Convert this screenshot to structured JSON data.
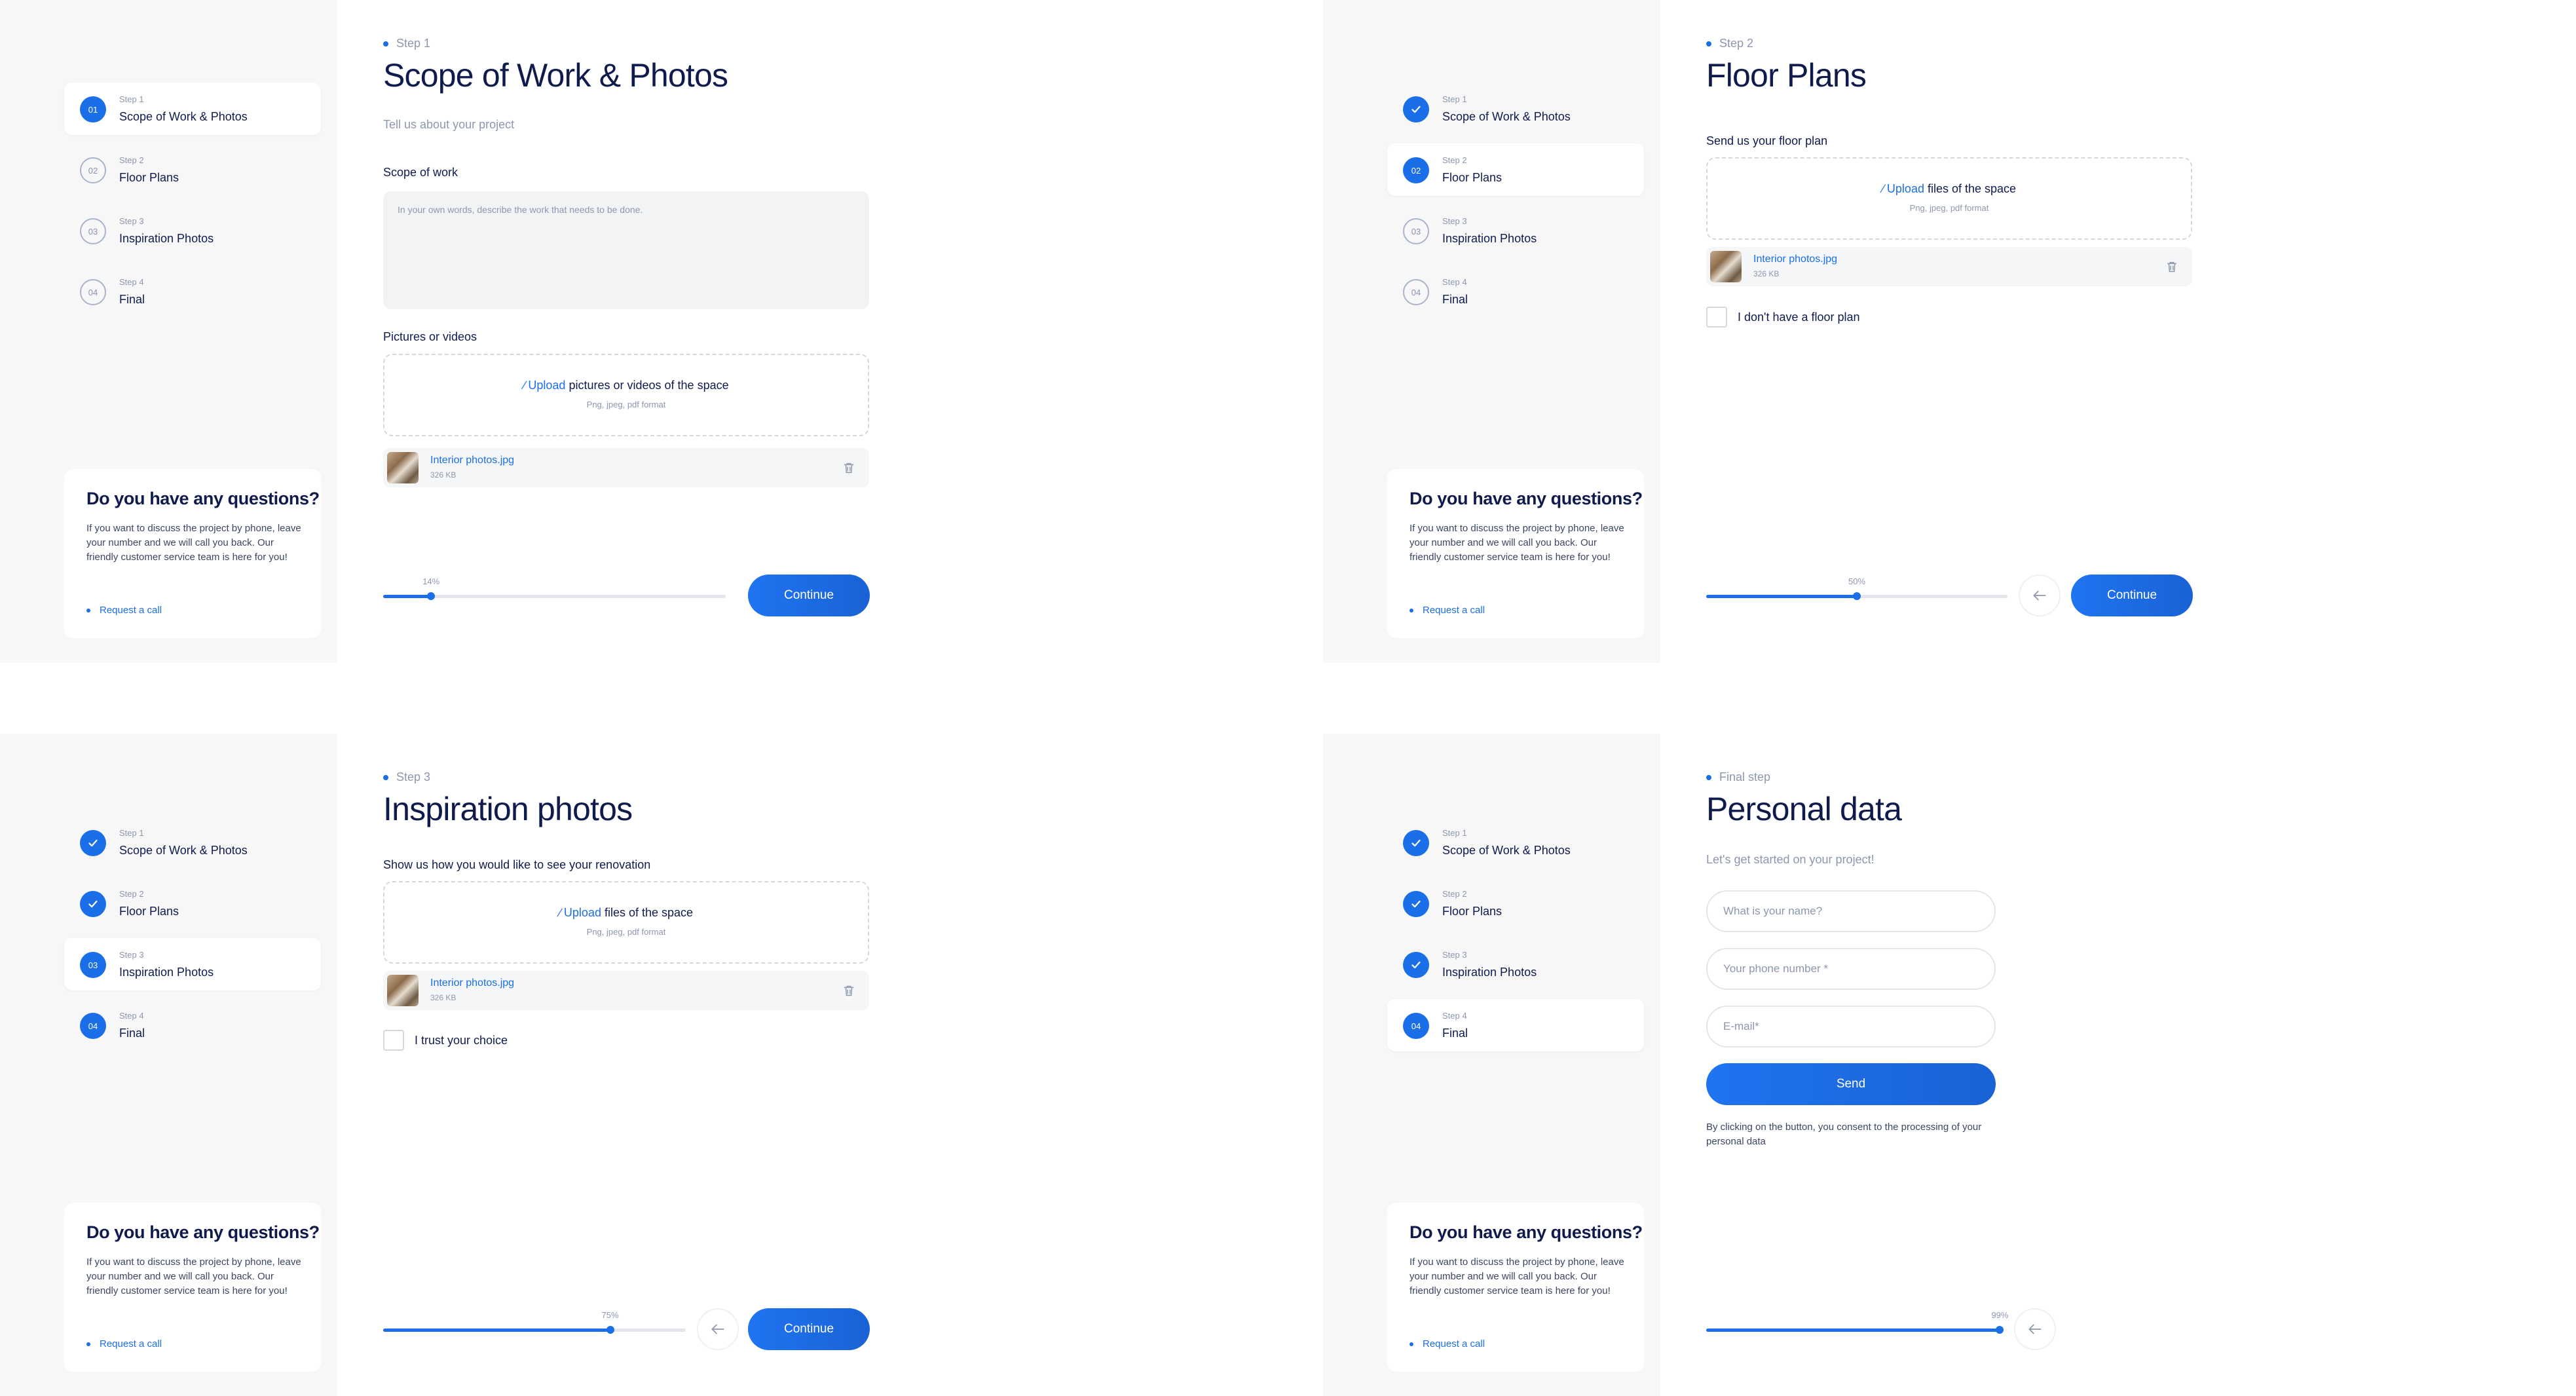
{
  "colors": {
    "accent": "#1a6fe8",
    "sidebar_bg": "#f7f7f8",
    "text_dark": "#0f1b4c",
    "text_muted": "#8d97ad"
  },
  "common": {
    "steps": [
      {
        "small": "Step 1",
        "name": "Scope of Work & Photos"
      },
      {
        "small": "Step 2",
        "name": "Floor Plans"
      },
      {
        "small": "Step 3",
        "name": "Inspiration Photos"
      },
      {
        "small": "Step 4",
        "name": "Final"
      }
    ],
    "step_numbers": [
      "01",
      "02",
      "03",
      "04"
    ],
    "question": {
      "title": "Do you have any questions?",
      "text": "If you want to discuss the project by phone, leave your number and we will call you back. Our friendly customer service team is here for you!",
      "link": "Request a call"
    },
    "continue_label": "Continue",
    "upload_word": "Upload",
    "upload_hint": "Png, jpeg, pdf format",
    "file_name": "Interior photos.jpg",
    "file_size": "326 KB",
    "icons": {
      "check": "check-icon",
      "back": "arrow-left-icon",
      "trash": "trash-icon",
      "clip": "paperclip-icon"
    }
  },
  "screens": {
    "step1": {
      "tag": "Step 1",
      "title": "Scope of Work & Photos",
      "subtitle": "Tell us about your project",
      "scope_label": "Scope of work",
      "scope_placeholder": "In your own words, describe the work that needs to be done.",
      "media_label": "Pictures or videos",
      "upload_rest": "pictures or videos of the space",
      "progress_label": "14%",
      "progress": 0.14
    },
    "step2": {
      "tag": "Step 2",
      "title": "Floor Plans",
      "subtitle": "Send us your floor plan",
      "upload_rest": "files of the space",
      "checkbox_label": "I don't have a floor plan",
      "progress_label": "50%",
      "progress": 0.5
    },
    "step3": {
      "tag": "Step 3",
      "title": "Inspiration photos",
      "subtitle": "Show us how you would like to see your renovation",
      "upload_rest": "files of the space",
      "checkbox_label": "I trust your choice",
      "progress_label": "75%",
      "progress": 0.75
    },
    "step4": {
      "tag": "Final step",
      "title": "Personal data",
      "subtitle": "Let's get started on your project!",
      "name_placeholder": "What is your name?",
      "phone_placeholder": "Your phone number *",
      "email_placeholder": "E-mail*",
      "send_label": "Send",
      "consent": "By clicking on the button, you consent to the processing of your personal data",
      "progress_label": "99%",
      "progress": 0.99
    }
  }
}
